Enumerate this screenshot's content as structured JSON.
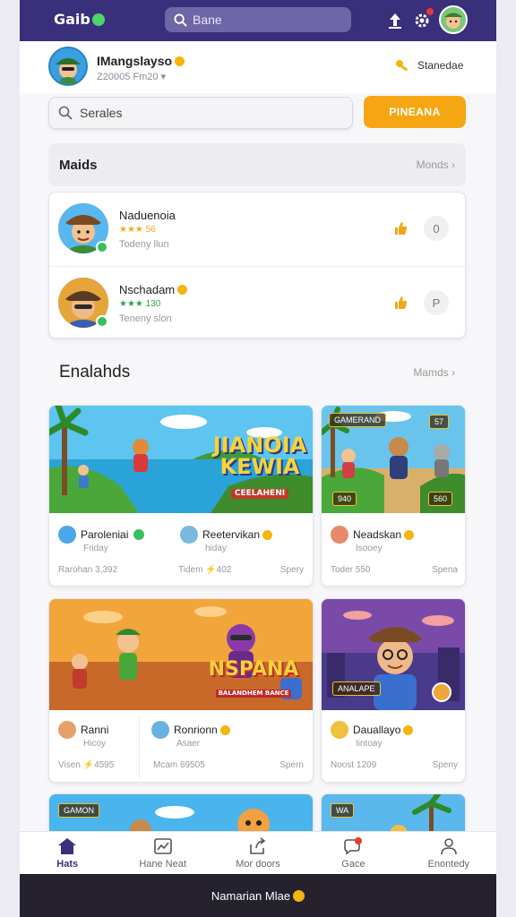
{
  "topbar": {
    "logo": "Gaib",
    "search_placeholder": "Bane",
    "notification_count": "1"
  },
  "profile": {
    "name": "IMangslayso",
    "sub": "Z20005 Fm20",
    "right_label": "Stanedae"
  },
  "search": {
    "placeholder": "Serales",
    "button": "PINEANA"
  },
  "friends_section": {
    "title": "Maids",
    "more": "Monds"
  },
  "friends": [
    {
      "name": "Naduenoia",
      "rating": "★★★ 56",
      "status": "Todeny llun",
      "action2": "0"
    },
    {
      "name": "Nschadam",
      "rating": "★★★ 130",
      "status": "Teneny slon",
      "action2": "P"
    }
  ],
  "games_section": {
    "title": "Enalahds",
    "more": "Mamds"
  },
  "cards": [
    {
      "title_line1": "JIANOIA",
      "title_line2": "KEWIA",
      "title_line3": "CEELAHENI",
      "players": [
        {
          "name": "Paroleniai",
          "sub": "Friday",
          "stat": "Rarohan 3,392"
        },
        {
          "name": "Reetervikan",
          "sub": "hiday",
          "stat": "Tidem ⚡402"
        }
      ],
      "right_stat": "Spery"
    },
    {
      "chip_left": "GAMERAND",
      "chip_right": "57",
      "chip_bl": "940",
      "chip_br": "560",
      "player": {
        "name": "Neadskan",
        "sub": "Isooey",
        "stat": "Toder 550"
      },
      "right_stat": "Spena"
    },
    {
      "title_line1": "NSPANA",
      "title_line2": "BALANDHEM BANCE",
      "players": [
        {
          "name": "Ranni",
          "sub": "Hicoy",
          "stat": "Visen ⚡4595"
        },
        {
          "name": "Ronrionn",
          "sub": "Asaer",
          "stat": "Mcam 69505"
        }
      ],
      "right_stat": "Spern"
    },
    {
      "chip_left": "ANALAPE",
      "player": {
        "name": "Dauallayo",
        "sub": "Iintoay",
        "stat": "Noost 1209"
      },
      "right_stat": "Speny"
    },
    {
      "chip_left": "GAMON"
    },
    {
      "chip_left": "WA"
    }
  ],
  "nav": [
    {
      "label": "Hats",
      "icon": "home-icon"
    },
    {
      "label": "Hane Neat",
      "icon": "leaderboard-icon"
    },
    {
      "label": "Mor doors",
      "icon": "share-icon"
    },
    {
      "label": "Gace",
      "icon": "chat-icon"
    },
    {
      "label": "Enontedy",
      "icon": "user-icon"
    }
  ],
  "footer": {
    "text": "Namarian Mlae"
  },
  "colors": {
    "brand": "#3a2f7a",
    "accent": "#f7a613",
    "online": "#37c15a"
  }
}
